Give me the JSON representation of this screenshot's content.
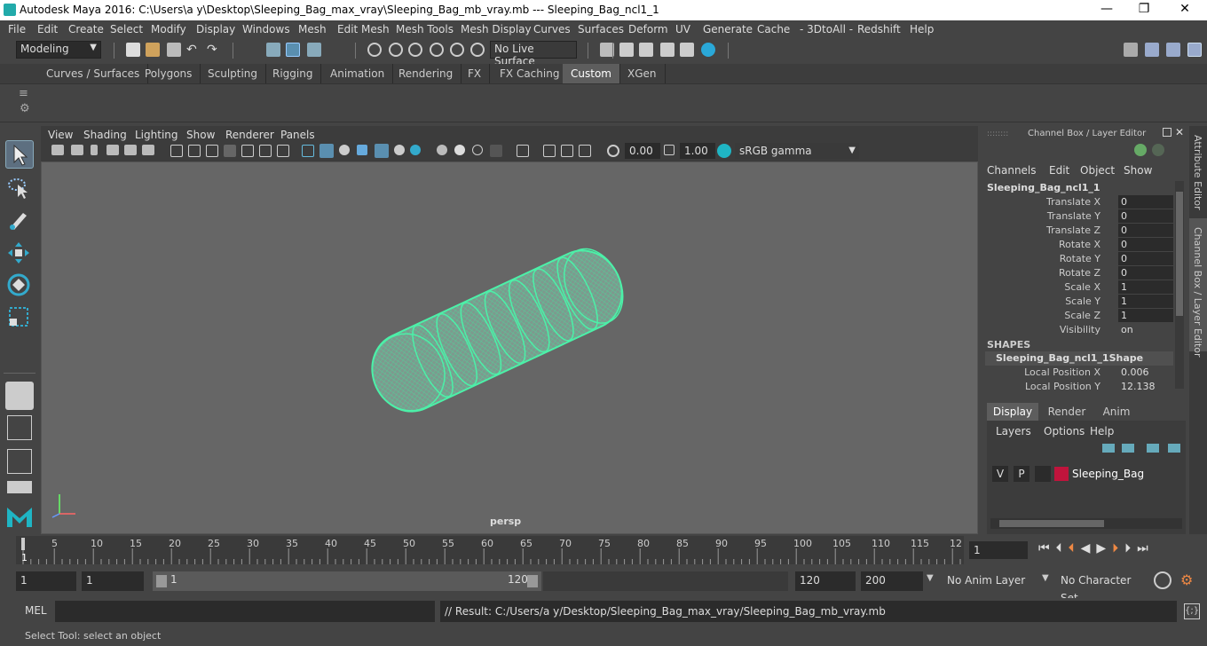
{
  "window": {
    "title": "Autodesk Maya 2016: C:\\Users\\a y\\Desktop\\Sleeping_Bag_max_vray\\Sleeping_Bag_mb_vray.mb   ---   Sleeping_Bag_ncl1_1",
    "minimize": "—",
    "maximize": "❐",
    "close": "✕"
  },
  "menu": [
    "File",
    "Edit",
    "Create",
    "Select",
    "Modify",
    "Display",
    "Windows",
    "Mesh",
    "Edit Mesh",
    "Mesh Tools",
    "Mesh Display",
    "Curves",
    "Surfaces",
    "Deform",
    "UV",
    "Generate",
    "Cache",
    "- 3DtoAll -",
    "Redshift",
    "Help"
  ],
  "status": {
    "mode": "Modeling",
    "live_surface": "No Live Surface"
  },
  "shelf_tabs": [
    "Curves / Surfaces",
    "Polygons",
    "Sculpting",
    "Rigging",
    "Animation",
    "Rendering",
    "FX",
    "FX Caching",
    "Custom",
    "XGen"
  ],
  "shelf_active": "Custom",
  "viewport": {
    "menu": [
      "View",
      "Shading",
      "Lighting",
      "Show",
      "Renderer",
      "Panels"
    ],
    "exposure": "0.00",
    "gamma": "1.00",
    "color_space": "sRGB gamma",
    "camera": "persp"
  },
  "channel_box": {
    "title": "Channel Box / Layer Editor",
    "menu": [
      "Channels",
      "Edit",
      "Object",
      "Show"
    ],
    "object": "Sleeping_Bag_ncl1_1",
    "channels": [
      {
        "label": "Translate X",
        "value": "0"
      },
      {
        "label": "Translate Y",
        "value": "0"
      },
      {
        "label": "Translate Z",
        "value": "0"
      },
      {
        "label": "Rotate X",
        "value": "0"
      },
      {
        "label": "Rotate Y",
        "value": "0"
      },
      {
        "label": "Rotate Z",
        "value": "0"
      },
      {
        "label": "Scale X",
        "value": "1"
      },
      {
        "label": "Scale Y",
        "value": "1"
      },
      {
        "label": "Scale Z",
        "value": "1"
      },
      {
        "label": "Visibility",
        "value": "on"
      }
    ],
    "shapes_header": "SHAPES",
    "shape_name": "Sleeping_Bag_ncl1_1Shape",
    "shape_channels": [
      {
        "label": "Local Position X",
        "value": "0.006"
      },
      {
        "label": "Local Position Y",
        "value": "12.138"
      }
    ]
  },
  "side_tabs": {
    "attribute": "Attribute Editor",
    "channel": "Channel Box / Layer Editor"
  },
  "layer_editor": {
    "tabs": [
      "Display",
      "Render",
      "Anim"
    ],
    "menu": [
      "Layers",
      "Options",
      "Help"
    ],
    "layer": {
      "v": "V",
      "p": "P",
      "name": "Sleeping_Bag",
      "color": "#c0143c"
    }
  },
  "timeline": {
    "ticks": [
      "1",
      "5",
      "10",
      "15",
      "20",
      "25",
      "30",
      "35",
      "40",
      "45",
      "50",
      "55",
      "60",
      "65",
      "70",
      "75",
      "80",
      "85",
      "90",
      "95",
      "100",
      "105",
      "110",
      "115",
      "12"
    ],
    "current_frame": "1"
  },
  "range": {
    "start": "1",
    "playback_start": "1",
    "slider_start": "1",
    "slider_end": "120",
    "playback_end": "120",
    "end": "200",
    "anim_layer": "No Anim Layer",
    "char_set": "No Character Set"
  },
  "command": {
    "lang": "MEL",
    "result": "// Result: C:/Users/a y/Desktop/Sleeping_Bag_max_vray/Sleeping_Bag_mb_vray.mb"
  },
  "help_line": "Select Tool: select an object",
  "colors": {
    "accent_tab": "#5d5d5d",
    "mesh_wire": "#4cf0a8",
    "layer_color": "#c0143c"
  }
}
